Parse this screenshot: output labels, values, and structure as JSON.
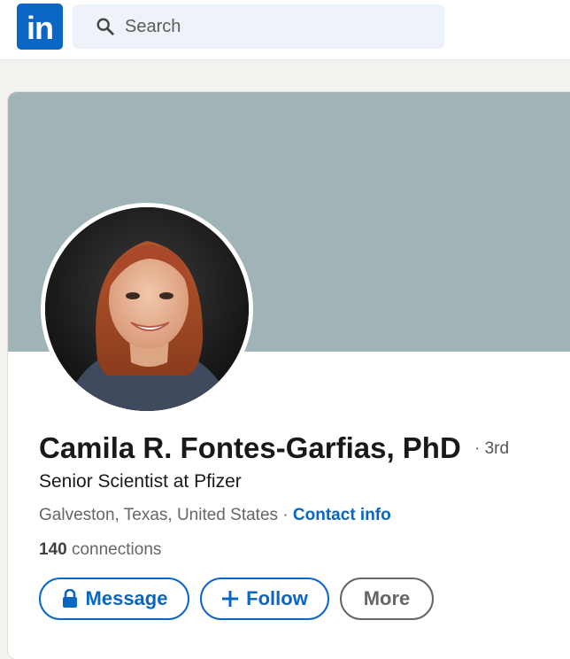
{
  "header": {
    "logo_text": "in",
    "search_placeholder": "Search",
    "brand_color": "#0a66c2"
  },
  "profile": {
    "name": "Camila R. Fontes-Garfias, PhD",
    "degree": "· 3rd",
    "headline": "Senior Scientist at Pfizer",
    "location": "Galveston, Texas, United States",
    "separator": "·",
    "contact_info": "Contact info",
    "connections_count": "140",
    "connections_label": "connections",
    "cover_color": "#a0b4b7"
  },
  "actions": {
    "message_label": "Message",
    "message_icon": "lock-icon",
    "follow_label": "Follow",
    "follow_icon": "plus-icon",
    "more_label": "More"
  }
}
